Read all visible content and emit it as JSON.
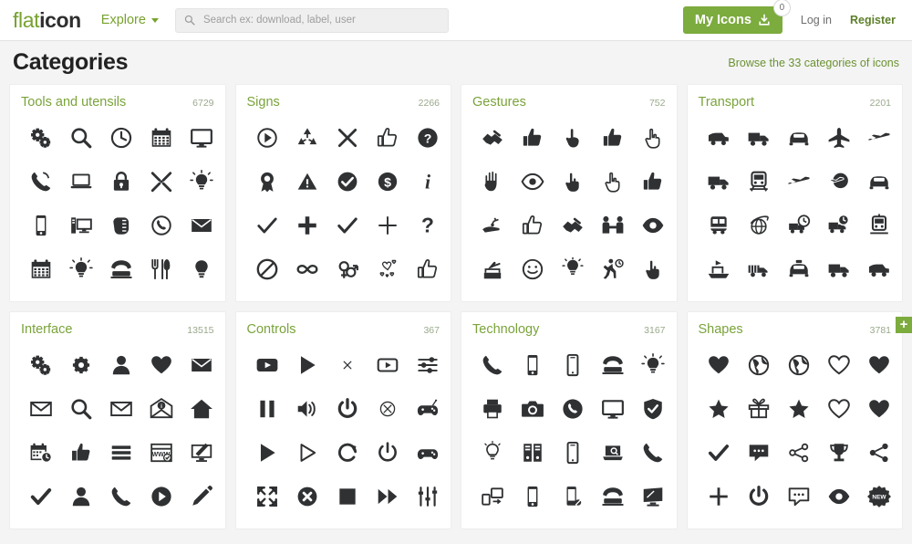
{
  "header": {
    "logo_a": "flat",
    "logo_b": "icon",
    "explore_label": "Explore",
    "search": {
      "placeholder": "Search ex: download, label, user",
      "value": "",
      "icon": "search-icon"
    },
    "my_icons_label": "My Icons",
    "my_icons_icon": "download-icon",
    "my_icons_badge": "0",
    "login_label": "Log in",
    "register_label": "Register",
    "accent_green": "#7cab3e",
    "link_green": "#5d7f2a"
  },
  "page": {
    "title": "Categories",
    "browse_link": "Browse the 33 categories of icons",
    "background": "#f4f4f4",
    "card_background": "#ffffff",
    "title_color": "#7aa33a",
    "count_color": "#9aa98c"
  },
  "add_button": {
    "label": "+",
    "color": "#7cab3e"
  },
  "categories": [
    {
      "name": "Tools and utensils",
      "count": "6729",
      "icons": [
        "gears-icon",
        "magnifier-icon",
        "clock-icon",
        "calendar-icon",
        "monitor-icon",
        "phone-call-icon",
        "laptop-icon",
        "padlock-icon",
        "tools-cross-icon",
        "idea-bulb-icon",
        "smartphone-icon",
        "desktop-setup-icon",
        "hand-swipe-icon",
        "phone-circle-icon",
        "envelope-icon",
        "calendar-tabs-icon",
        "lightbulb-rays-icon",
        "telephone-icon",
        "cutlery-icon",
        "bulb-filled-icon"
      ]
    },
    {
      "name": "Signs",
      "count": "2266",
      "icons": [
        "play-circle-icon",
        "recycle-icon",
        "cross-x-icon",
        "thumbs-up-outline-icon",
        "question-circle-icon",
        "award-ribbon-icon",
        "warning-triangle-icon",
        "check-circle-icon",
        "dollar-circle-icon",
        "info-italic-icon",
        "check-thin-icon",
        "plus-bold-icon",
        "check-mark-icon",
        "plus-thin-icon",
        "question-mark-icon",
        "prohibited-icon",
        "infinity-icon",
        "gender-icon",
        "hearts-scatter-icon",
        "thumbs-up-line-icon"
      ]
    },
    {
      "name": "Gestures",
      "count": "752",
      "icons": [
        "handshake-icon",
        "thumbs-up-filled-icon",
        "hand-point-up-icon",
        "like-badge-icon",
        "hand-tap-outline-icon",
        "open-hand-icon",
        "eye-icon",
        "finger-touch-icon",
        "hand-click-outline-icon",
        "thumbs-up-small-icon",
        "hand-seed-icon",
        "thumbs-up-outline2-icon",
        "handshake-deal-icon",
        "people-shake-icon",
        "eye-filled-icon",
        "hand-vote-icon",
        "smiley-face-icon",
        "idea-hand-icon",
        "running-clock-icon",
        "finger-press-icon"
      ]
    },
    {
      "name": "Transport",
      "count": "2201",
      "icons": [
        "van-icon",
        "delivery-truck-icon",
        "car-front-icon",
        "airplane-icon",
        "airplane-tilt-icon",
        "truck-icon",
        "train-front-icon",
        "plane-side-icon",
        "globe-plane-icon",
        "car-icon",
        "bus-icon",
        "globe-orbit-icon",
        "fast-delivery-icon",
        "truck-clock-icon",
        "tram-icon",
        "boat-icon",
        "cargo-truck-icon",
        "taxi-icon",
        "box-truck-icon",
        "pickup-truck-icon"
      ]
    },
    {
      "name": "Interface",
      "count": "13515",
      "icons": [
        "settings-gears-icon",
        "gear-icon",
        "user-icon",
        "heart-filled-icon",
        "mail-open-icon",
        "envelope-outline-icon",
        "search-icon",
        "mail-line-icon",
        "mail-info-icon",
        "home-icon",
        "calendar-clock-icon",
        "thumbs-up-box-icon",
        "menu-lines-icon",
        "browser-www-icon",
        "screen-edit-icon",
        "check-bold-icon",
        "avatar-icon",
        "phone-handset-icon",
        "play-button-icon",
        "pencil-icon"
      ]
    },
    {
      "name": "Controls",
      "count": "367",
      "icons": [
        "video-play-icon",
        "play-triangle-icon",
        "close-small-icon",
        "play-rounded-icon",
        "sliders-icon",
        "pause-icon",
        "volume-icon",
        "power-icon",
        "close-circle-thin-icon",
        "gamepad-icon",
        "play-solid-icon",
        "play-outline-icon",
        "refresh-icon",
        "power-outline-icon",
        "controller-icon",
        "fullscreen-icon",
        "close-circle-icon",
        "stop-icon",
        "fast-forward-icon",
        "equalizer-icon"
      ]
    },
    {
      "name": "Technology",
      "count": "3167",
      "icons": [
        "phone-receiver-icon",
        "mobile-icon",
        "smartphone-outline-icon",
        "old-telephone-icon",
        "bulb-bright-icon",
        "printer-icon",
        "camera-icon",
        "phone-circle-filled-icon",
        "monitor-screen-icon",
        "shield-check-icon",
        "bulb-outline-icon",
        "servers-icon",
        "phone-blank-icon",
        "laptop-search-icon",
        "phone-small-icon",
        "devices-sync-icon",
        "mobile-blank-icon",
        "phone-data-icon",
        "telephone-retro-icon",
        "monitor-tilt-icon"
      ]
    },
    {
      "name": "Shapes",
      "count": "3781",
      "icons": [
        "heart-solid-icon",
        "globe-circle-icon",
        "earth-icon",
        "heart-outline-icon",
        "heart-bold-icon",
        "star-icon",
        "gift-icon",
        "star-filled-icon",
        "heart-line-icon",
        "heart-big-icon",
        "check-shape-icon",
        "chat-bubbles-icon",
        "share-nodes-icon",
        "trophy-icon",
        "share-icon",
        "plus-icon",
        "power-shape-icon",
        "speech-bubble-icon",
        "eye-shape-icon",
        "new-badge-icon"
      ]
    }
  ]
}
